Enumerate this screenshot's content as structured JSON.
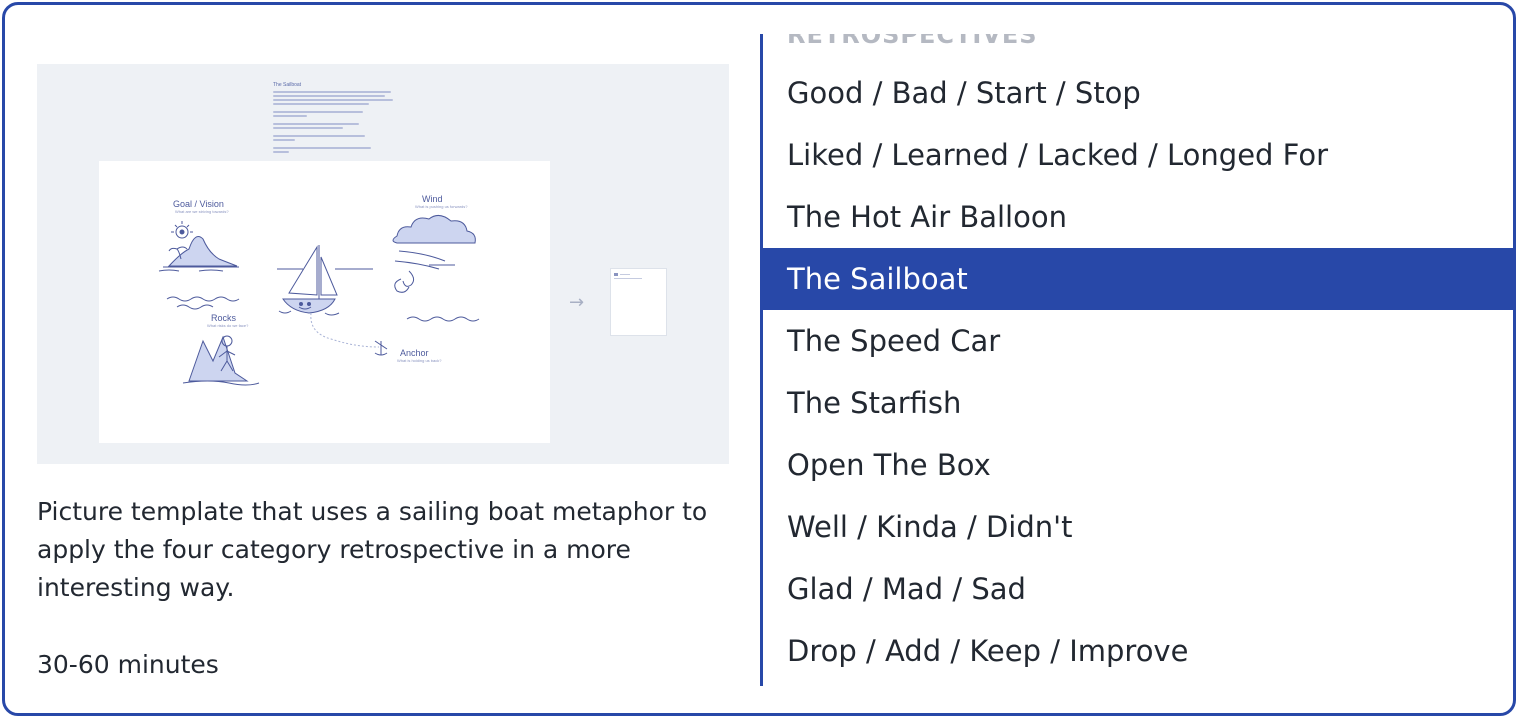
{
  "template": {
    "preview": {
      "heading": "The Sailboat",
      "goal_label": "Goal / Vision",
      "goal_prompt": "What are we striving towards?",
      "wind_label": "Wind",
      "wind_prompt": "What is pushing us forwards?",
      "rocks_label": "Rocks",
      "rocks_prompt": "What risks do we face?",
      "anchor_label": "Anchor",
      "anchor_prompt": "What is holding us back?",
      "next_icon": "arrow-right-icon",
      "colors": {
        "background": "#eef1f5",
        "sketch": "#4d5a9c",
        "fill": "#cdd5f0"
      }
    },
    "description": "Picture template that uses a sailing boat metaphor to apply the four category retrospective in a more interesting way.",
    "duration": "30-60 minutes"
  },
  "retrospectives": {
    "header": "RETROSPECTIVES",
    "items": [
      {
        "label": "Good / Bad / Start / Stop",
        "selected": false
      },
      {
        "label": "Liked / Learned / Lacked / Longed For",
        "selected": false
      },
      {
        "label": "The Hot Air Balloon",
        "selected": false
      },
      {
        "label": "The Sailboat",
        "selected": true
      },
      {
        "label": "The Speed Car",
        "selected": false
      },
      {
        "label": "The Starfish",
        "selected": false
      },
      {
        "label": "Open The Box",
        "selected": false
      },
      {
        "label": "Well / Kinda / Didn't",
        "selected": false
      },
      {
        "label": "Glad / Mad / Sad",
        "selected": false
      },
      {
        "label": "Drop / Add / Keep / Improve",
        "selected": false
      }
    ]
  },
  "colors": {
    "accent": "#2848a8",
    "text": "#222831",
    "header_text": "#b5b9c2",
    "selected_text": "#ffffff"
  }
}
